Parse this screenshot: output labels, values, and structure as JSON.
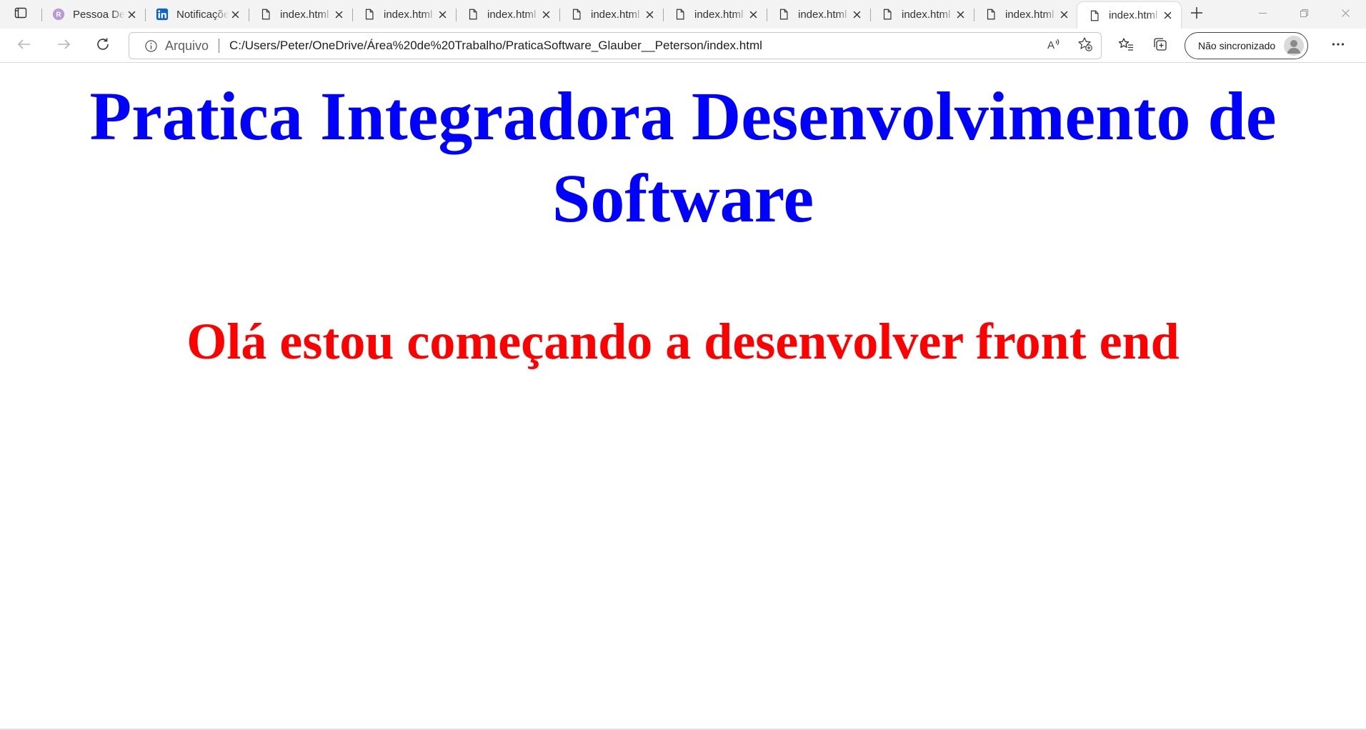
{
  "browser": {
    "tabs": [
      {
        "title": "Pessoa Desenvolvedora",
        "icon": "app-r-icon",
        "active": false
      },
      {
        "title": "Notificações | LinkedIn",
        "icon": "linkedin-icon",
        "active": false
      },
      {
        "title": "index.html",
        "icon": "page-icon",
        "active": false
      },
      {
        "title": "index.html",
        "icon": "page-icon",
        "active": false
      },
      {
        "title": "index.html",
        "icon": "page-icon",
        "active": false
      },
      {
        "title": "index.html",
        "icon": "page-icon",
        "active": false
      },
      {
        "title": "index.html",
        "icon": "page-icon",
        "active": false
      },
      {
        "title": "index.html",
        "icon": "page-icon",
        "active": false
      },
      {
        "title": "index.html",
        "icon": "page-icon",
        "active": false
      },
      {
        "title": "index.html",
        "icon": "page-icon",
        "active": false
      },
      {
        "title": "index.html",
        "icon": "page-icon",
        "active": true
      }
    ],
    "address": {
      "scheme_label": "Arquivo",
      "url": "C:/Users/Peter/OneDrive/Área%20de%20Trabalho/PraticaSoftware_Glauber__Peterson/index.html"
    },
    "profile": {
      "label": "Não sincronizado"
    }
  },
  "page": {
    "heading": "Pratica Integradora Desenvolvimento de Software",
    "subheading": "Olá estou começando a desenvolver front end",
    "heading_color": "#0000ff",
    "subheading_color": "#ff0000"
  }
}
